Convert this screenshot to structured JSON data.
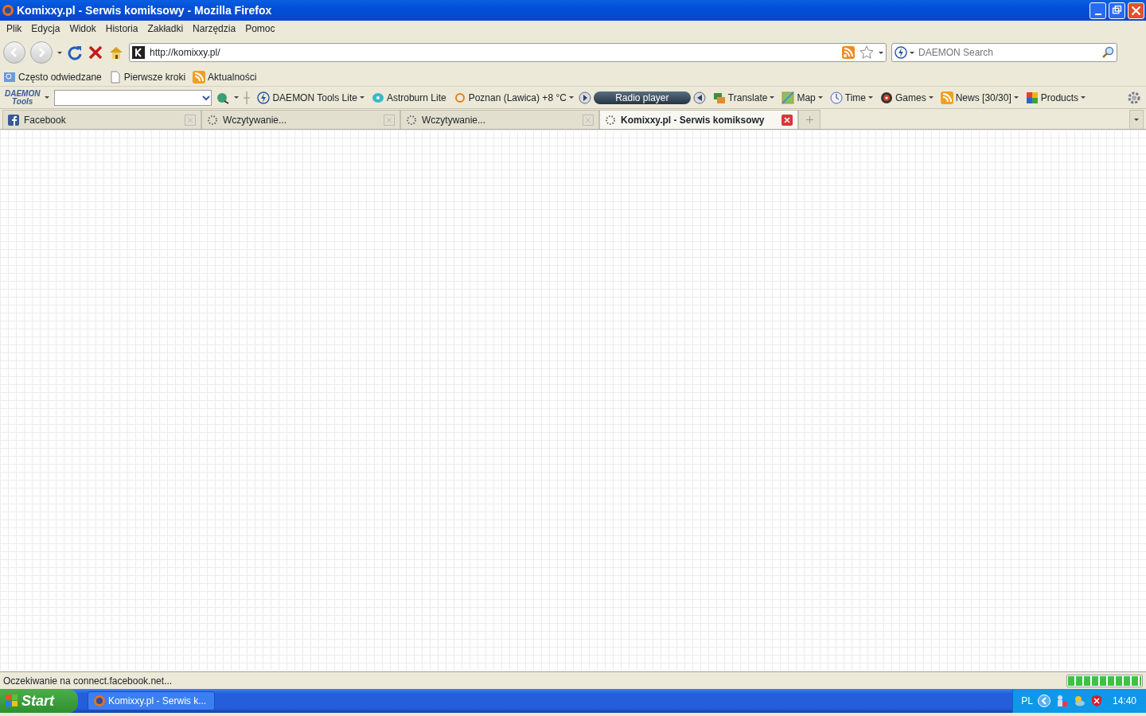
{
  "window": {
    "title": "Komixxy.pl - Serwis komiksowy - Mozilla Firefox"
  },
  "menu": [
    "Plik",
    "Edycja",
    "Widok",
    "Historia",
    "Zakładki",
    "Narzędzia",
    "Pomoc"
  ],
  "navigation": {
    "url": "http://komixxy.pl/",
    "search_placeholder": "DAEMON Search"
  },
  "bookmarks": [
    "Często odwiedzane",
    "Pierwsze kroki",
    "Aktualności"
  ],
  "daemon_toolbar": {
    "logo_top": "DAEMON",
    "logo_bottom": "Tools",
    "radio": "Radio player",
    "items": [
      {
        "label": "DAEMON Tools Lite",
        "dropdown": true
      },
      {
        "label": "Astroburn Lite",
        "dropdown": false
      },
      {
        "label": "Poznan (Lawica) +8 °C",
        "dropdown": true
      },
      {
        "label": "Translate",
        "dropdown": true
      },
      {
        "label": "Map",
        "dropdown": true
      },
      {
        "label": "Time",
        "dropdown": true
      },
      {
        "label": "Games",
        "dropdown": true
      },
      {
        "label": "News [30/30]",
        "dropdown": true
      },
      {
        "label": "Products",
        "dropdown": true
      }
    ]
  },
  "tabs": [
    {
      "label": "Facebook",
      "kind": "site",
      "selected": false
    },
    {
      "label": "Wczytywanie...",
      "kind": "loading",
      "selected": false
    },
    {
      "label": "Wczytywanie...",
      "kind": "loading",
      "selected": false
    },
    {
      "label": "Komixxy.pl - Serwis komiksowy",
      "kind": "loading",
      "selected": true
    }
  ],
  "status_bar": {
    "text": "Oczekiwanie na connect.facebook.net...",
    "level": 1
  },
  "taskbar": {
    "start": "Start",
    "task": "Komixxy.pl - Serwis k...",
    "language": "PL",
    "clock": "14:40"
  }
}
